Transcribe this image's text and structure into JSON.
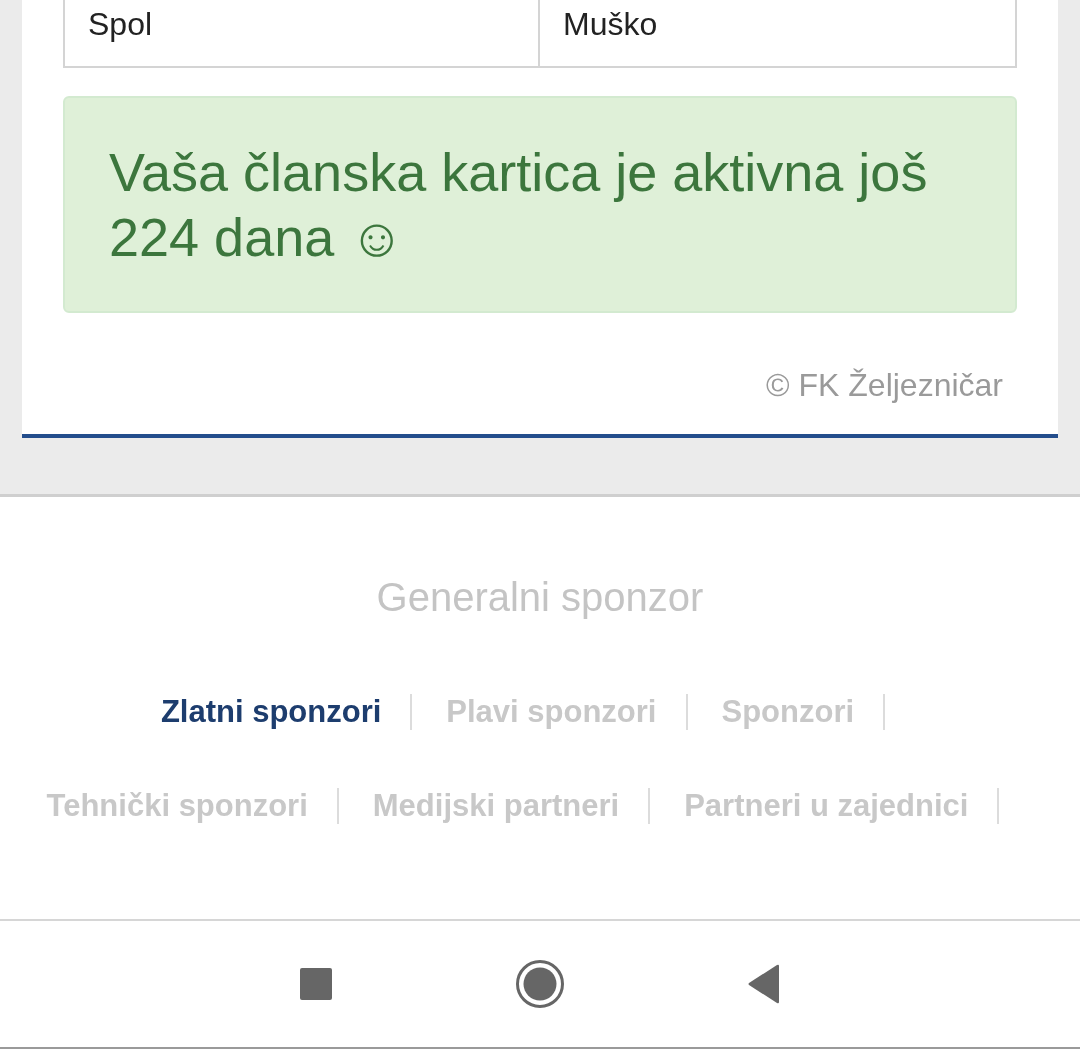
{
  "table": {
    "rows": [
      {
        "label": "Spol",
        "value": "Muško"
      }
    ]
  },
  "alert": {
    "message": "Vaša članska kartica je aktivna još 224 dana ☺"
  },
  "copyright": "© FK Željezničar",
  "sponsors": {
    "title": "Generalni sponzor",
    "category_rows": [
      {
        "tabs": [
          {
            "label": "Zlatni sponzori",
            "selected": true
          },
          {
            "label": "Plavi sponzori",
            "selected": false
          },
          {
            "label": "Sponzori",
            "selected": false
          }
        ]
      },
      {
        "tabs": [
          {
            "label": "Tehnički sponzori",
            "selected": false
          },
          {
            "label": "Medijski partneri",
            "selected": false
          },
          {
            "label": "Partneri u zajednici",
            "selected": false
          }
        ]
      }
    ]
  }
}
